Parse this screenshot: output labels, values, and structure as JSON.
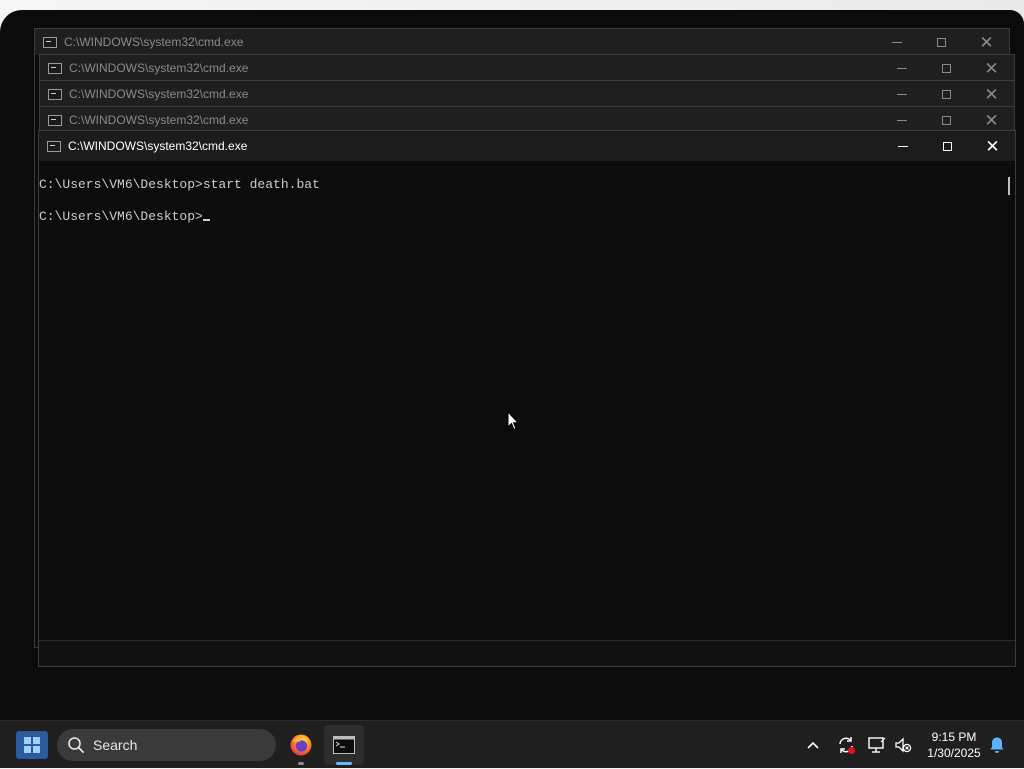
{
  "windows": [
    {
      "title": "C:\\WINDOWS\\system32\\cmd.exe"
    },
    {
      "title": "C:\\WINDOWS\\system32\\cmd.exe"
    },
    {
      "title": "C:\\WINDOWS\\system32\\cmd.exe"
    },
    {
      "title": "C:\\WINDOWS\\system32\\cmd.exe"
    },
    {
      "title": "C:\\WINDOWS\\system32\\cmd.exe"
    }
  ],
  "console": {
    "lines": [
      "C:\\Users\\VM6\\Desktop>start death.bat",
      "",
      "C:\\Users\\VM6\\Desktop>"
    ]
  },
  "taskbar": {
    "search_label": "Search",
    "apps": [
      {
        "name": "Firefox",
        "icon": "firefox-icon"
      },
      {
        "name": "Command Prompt",
        "icon": "terminal-icon"
      }
    ],
    "clock": {
      "time": "9:15 PM",
      "date": "1/30/2025"
    }
  },
  "colors": {
    "console_bg": "#0c0c0c",
    "console_fg": "#cccccc",
    "taskbar_bg": "#1f1f1f",
    "accent": "#6ab7ff"
  }
}
